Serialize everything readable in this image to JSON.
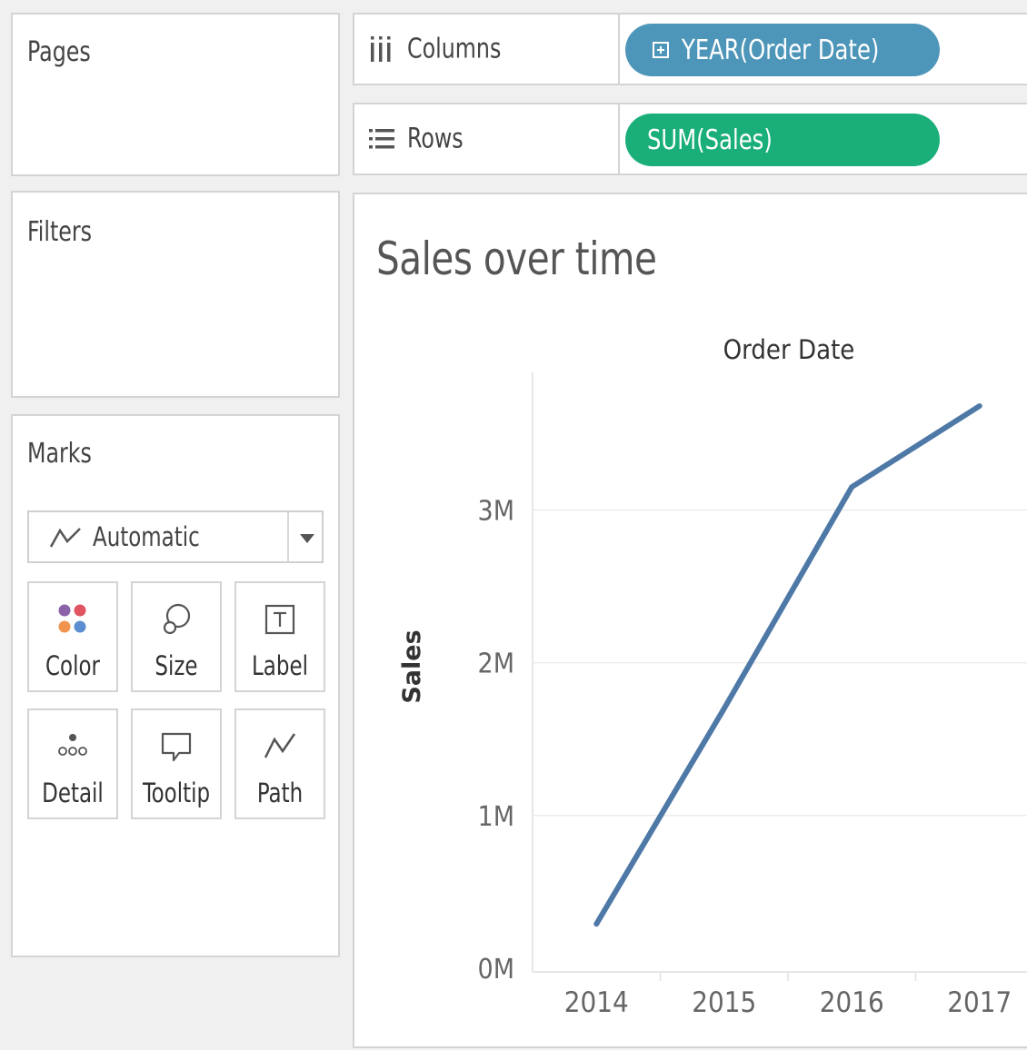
{
  "pages": {
    "title": "Pages"
  },
  "filters": {
    "title": "Filters"
  },
  "marks": {
    "title": "Marks",
    "mark_type": "Automatic",
    "cards": [
      {
        "label": "Color",
        "icon": "color-icon"
      },
      {
        "label": "Size",
        "icon": "size-icon"
      },
      {
        "label": "Label",
        "icon": "label-icon"
      },
      {
        "label": "Detail",
        "icon": "detail-icon"
      },
      {
        "label": "Tooltip",
        "icon": "tooltip-icon"
      },
      {
        "label": "Path",
        "icon": "path-icon"
      }
    ]
  },
  "shelves": {
    "columns": {
      "label": "Columns",
      "pill": "YEAR(Order Date)",
      "pill_color": "#4e96b9"
    },
    "rows": {
      "label": "Rows",
      "pill": "SUM(Sales)",
      "pill_color": "#1aae78"
    }
  },
  "view": {
    "title": "Sales over time"
  },
  "chart_data": {
    "type": "line",
    "title": "Sales over time",
    "xlabel": "Order Date",
    "ylabel": "Sales",
    "categories": [
      "2014",
      "2015",
      "2016",
      "2017"
    ],
    "series": [
      {
        "values": [
          290000,
          1700000,
          3150000,
          3680000
        ],
        "color": "#4e79a7"
      }
    ],
    "ylim": [
      0,
      3900000
    ],
    "yticks": [
      {
        "value": 0,
        "label": "0M"
      },
      {
        "value": 1000000,
        "label": "1M"
      },
      {
        "value": 2000000,
        "label": "2M"
      },
      {
        "value": 3000000,
        "label": "3M"
      }
    ],
    "xlabel_position": "top",
    "grid": true
  }
}
